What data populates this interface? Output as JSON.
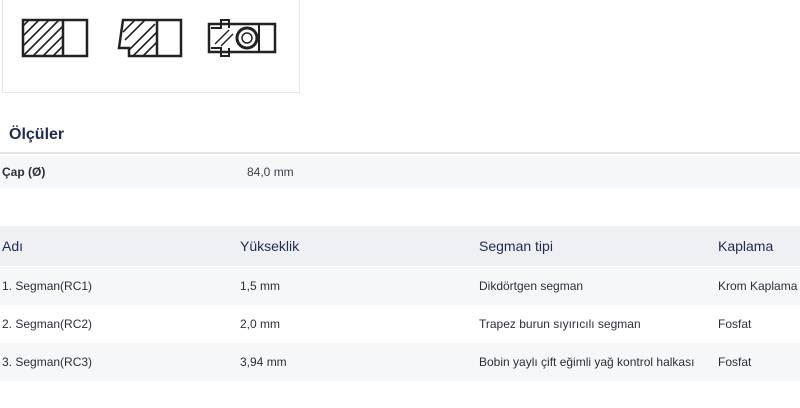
{
  "images": [
    {
      "icon": "ring-rectangular-icon"
    },
    {
      "icon": "ring-taper-scraper-icon"
    },
    {
      "icon": "ring-oil-control-coil-icon"
    }
  ],
  "dimensions": {
    "title": "Ölçüler",
    "rows": [
      {
        "label": "Çap (Ø)",
        "value": "84,0 mm"
      }
    ]
  },
  "rings_table": {
    "headers": [
      "Adı",
      "Yükseklik",
      "Segman tipi",
      "Kaplama"
    ],
    "rows": [
      [
        "1. Segman(RC1)",
        "1,5 mm",
        "Dikdörtgen segman",
        "Krom Kaplama"
      ],
      [
        "2. Segman(RC2)",
        "2,0 mm",
        "Trapez burun sıyırıcılı segman",
        "Fosfat"
      ],
      [
        "3. Segman(RC3)",
        "3,94 mm",
        "Bobin yaylı çift eğimli yağ kontrol halkası",
        "Fosfat"
      ]
    ]
  },
  "colors": {
    "heading": "#1f2a57",
    "row_alt": "#f6f7f9",
    "header_bg": "#eef0f4"
  }
}
